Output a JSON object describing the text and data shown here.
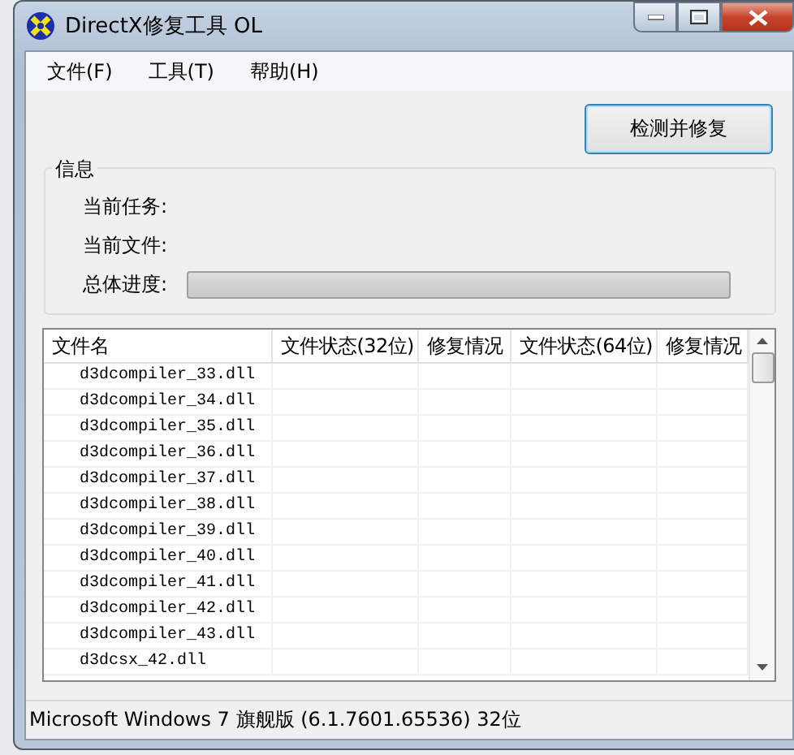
{
  "window": {
    "title": "DirectX修复工具 OL"
  },
  "menu": [
    "文件(F)",
    "工具(T)",
    "帮助(H)"
  ],
  "action_button": "检测并修复",
  "info": {
    "title": "信息",
    "fields": [
      {
        "label": "当前任务:"
      },
      {
        "label": "当前文件:"
      }
    ],
    "progress": {
      "label": "总体进度:",
      "level": 0
    }
  },
  "table": {
    "columns": [
      "文件名",
      "文件状态(32位)",
      "修复情况",
      "文件状态(64位)",
      "修复情况"
    ],
    "rows": [
      [
        "d3dcompiler_33.dll"
      ],
      [
        "d3dcompiler_34.dll"
      ],
      [
        "d3dcompiler_35.dll"
      ],
      [
        "d3dcompiler_36.dll"
      ],
      [
        "d3dcompiler_37.dll"
      ],
      [
        "d3dcompiler_38.dll"
      ],
      [
        "d3dcompiler_39.dll"
      ],
      [
        "d3dcompiler_40.dll"
      ],
      [
        "d3dcompiler_41.dll"
      ],
      [
        "d3dcompiler_42.dll"
      ],
      [
        "d3dcompiler_43.dll"
      ],
      [
        "d3dcsx_42.dll"
      ]
    ]
  },
  "status_bar": "Microsoft Windows 7 旗舰版 (6.1.7601.65536) 32位"
}
